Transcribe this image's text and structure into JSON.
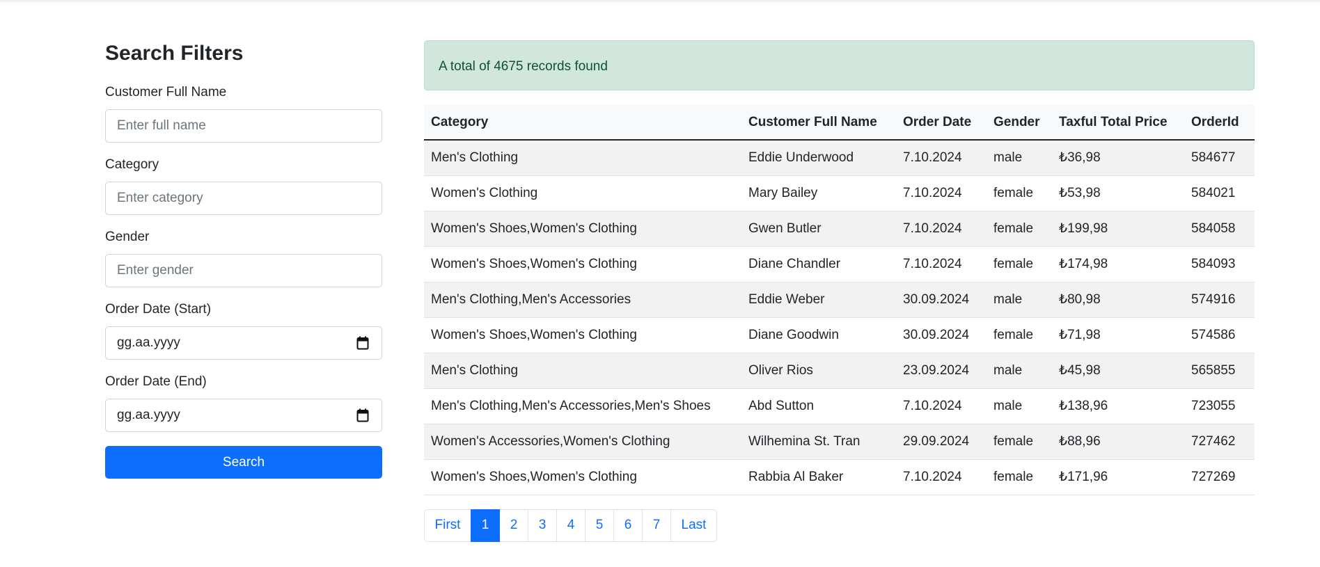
{
  "filters": {
    "title": "Search Filters",
    "customer_name": {
      "label": "Customer Full Name",
      "placeholder": "Enter full name"
    },
    "category": {
      "label": "Category",
      "placeholder": "Enter category"
    },
    "gender": {
      "label": "Gender",
      "placeholder": "Enter gender"
    },
    "order_date_start": {
      "label": "Order Date (Start)",
      "placeholder": "gg.aa.yyyy"
    },
    "order_date_end": {
      "label": "Order Date (End)",
      "placeholder": "gg.aa.yyyy"
    },
    "search_label": "Search"
  },
  "results": {
    "summary": "A total of 4675 records found",
    "columns": [
      "Category",
      "Customer Full Name",
      "Order Date",
      "Gender",
      "Taxful Total Price",
      "OrderId"
    ],
    "rows": [
      [
        "Men's Clothing",
        "Eddie Underwood",
        "7.10.2024",
        "male",
        "₺36,98",
        "584677"
      ],
      [
        "Women's Clothing",
        "Mary Bailey",
        "7.10.2024",
        "female",
        "₺53,98",
        "584021"
      ],
      [
        "Women's Shoes,Women's Clothing",
        "Gwen Butler",
        "7.10.2024",
        "female",
        "₺199,98",
        "584058"
      ],
      [
        "Women's Shoes,Women's Clothing",
        "Diane Chandler",
        "7.10.2024",
        "female",
        "₺174,98",
        "584093"
      ],
      [
        "Men's Clothing,Men's Accessories",
        "Eddie Weber",
        "30.09.2024",
        "male",
        "₺80,98",
        "574916"
      ],
      [
        "Women's Shoes,Women's Clothing",
        "Diane Goodwin",
        "30.09.2024",
        "female",
        "₺71,98",
        "574586"
      ],
      [
        "Men's Clothing",
        "Oliver Rios",
        "23.09.2024",
        "male",
        "₺45,98",
        "565855"
      ],
      [
        "Men's Clothing,Men's Accessories,Men's Shoes",
        "Abd Sutton",
        "7.10.2024",
        "male",
        "₺138,96",
        "723055"
      ],
      [
        "Women's Accessories,Women's Clothing",
        "Wilhemina St. Tran",
        "29.09.2024",
        "female",
        "₺88,96",
        "727462"
      ],
      [
        "Women's Shoes,Women's Clothing",
        "Rabbia Al Baker",
        "7.10.2024",
        "female",
        "₺171,96",
        "727269"
      ]
    ]
  },
  "pagination": {
    "first": "First",
    "pages": [
      "1",
      "2",
      "3",
      "4",
      "5",
      "6",
      "7"
    ],
    "active_page": "1",
    "last": "Last"
  },
  "colors": {
    "primary": "#0d6efd",
    "alert_bg": "#d1e7dd",
    "alert_text": "#0f5132",
    "stripe": "#f2f2f2"
  },
  "icons": {
    "date_picker": "calendar-icon"
  }
}
